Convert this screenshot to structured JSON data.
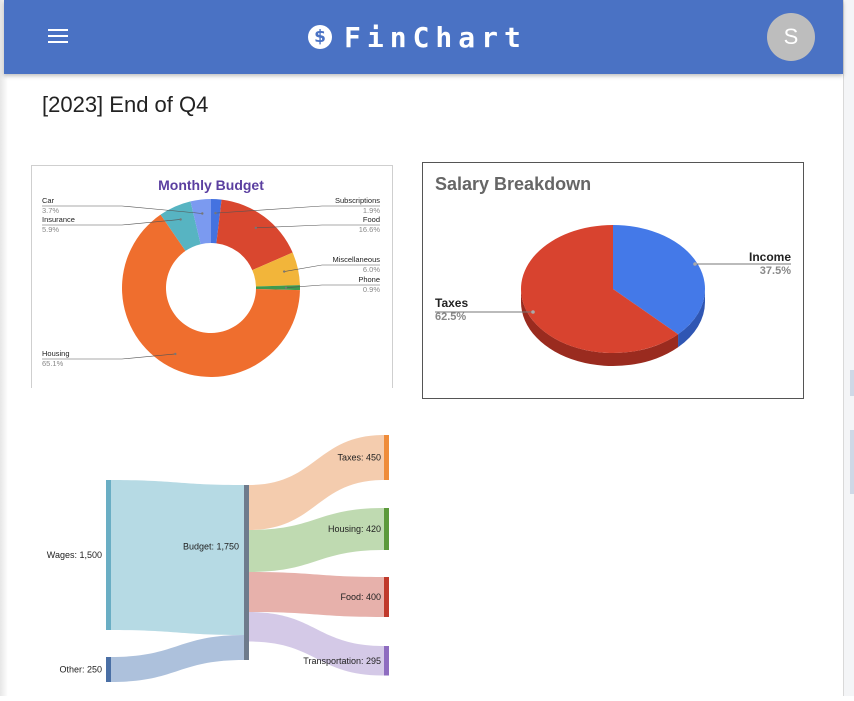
{
  "app": {
    "name": "FinChart",
    "logo_glyph": "$",
    "avatar_initial": "S",
    "menu_icon": "hamburger-menu-icon",
    "colors": {
      "appbar": "#4a72c4",
      "avatar": "#bdbdbd"
    }
  },
  "page": {
    "title": "[2023] End of Q4"
  },
  "chart_data": [
    {
      "type": "pie",
      "variant": "donut",
      "title": "Monthly Budget",
      "legend": "none",
      "slices": [
        {
          "label": "Subscriptions",
          "value": 1.9,
          "display": "1.9%",
          "color": "#4472e0"
        },
        {
          "label": "Food",
          "value": 16.6,
          "display": "16.6%",
          "color": "#d9472f"
        },
        {
          "label": "Miscellaneous",
          "value": 6.0,
          "display": "6.0%",
          "color": "#f2b53a"
        },
        {
          "label": "Phone",
          "value": 0.9,
          "display": "0.9%",
          "color": "#3e9a4f"
        },
        {
          "label": "Housing",
          "value": 65.1,
          "display": "65.1%",
          "color": "#ef6e2e"
        },
        {
          "label": "Insurance",
          "value": 5.9,
          "display": "5.9%",
          "color": "#57b4c2"
        },
        {
          "label": "Car",
          "value": 3.7,
          "display": "3.7%",
          "color": "#7b9af0"
        }
      ]
    },
    {
      "type": "pie",
      "variant": "3d",
      "title": "Salary Breakdown",
      "legend": "none",
      "slices": [
        {
          "label": "Income",
          "value": 37.5,
          "display": "37.5%",
          "color": "#4479e8"
        },
        {
          "label": "Taxes",
          "value": 62.5,
          "display": "62.5%",
          "color": "#d8432f"
        }
      ]
    },
    {
      "type": "sankey",
      "title": "",
      "nodes": [
        {
          "id": "wages",
          "label": "Wages: 1,500",
          "value": 1500,
          "color": "#6aaec4"
        },
        {
          "id": "other",
          "label": "Other: 250",
          "value": 250,
          "color": "#4a6fa5"
        },
        {
          "id": "budget",
          "label": "Budget: 1,750",
          "value": 1750,
          "color": "#6e7b8c"
        },
        {
          "id": "taxes",
          "label": "Taxes: 450",
          "value": 450,
          "color": "#ef8c3a"
        },
        {
          "id": "housing",
          "label": "Housing: 420",
          "value": 420,
          "color": "#5b9a3a"
        },
        {
          "id": "food",
          "label": "Food: 400",
          "value": 400,
          "color": "#c0392b"
        },
        {
          "id": "transportation",
          "label": "Transportation: 295",
          "value": 295,
          "color": "#8e6cc0"
        }
      ],
      "links": [
        {
          "source": "wages",
          "target": "budget",
          "value": 1500,
          "color": "#a9d3df"
        },
        {
          "source": "other",
          "target": "budget",
          "value": 250,
          "color": "#9fb6d6"
        },
        {
          "source": "budget",
          "target": "taxes",
          "value": 450,
          "color": "#f2c3a0"
        },
        {
          "source": "budget",
          "target": "housing",
          "value": 420,
          "color": "#b4d3a3"
        },
        {
          "source": "budget",
          "target": "food",
          "value": 400,
          "color": "#e3a39c"
        },
        {
          "source": "budget",
          "target": "transportation",
          "value": 295,
          "color": "#cdbfe3"
        }
      ]
    }
  ]
}
